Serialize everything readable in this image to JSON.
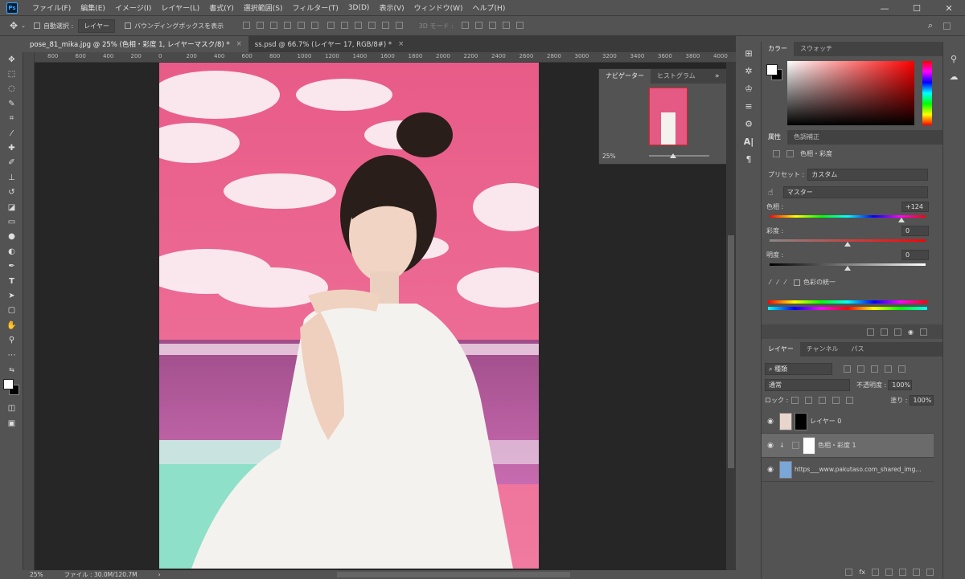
{
  "app": {
    "logo": "Ps"
  },
  "menu": [
    "ファイル(F)",
    "編集(E)",
    "イメージ(I)",
    "レイヤー(L)",
    "書式(Y)",
    "選択範囲(S)",
    "フィルター(T)",
    "3D(D)",
    "表示(V)",
    "ウィンドウ(W)",
    "ヘルプ(H)"
  ],
  "window_controls": {
    "minimize": "—",
    "maximize": "☐",
    "close": "✕"
  },
  "options": {
    "auto_select_label": "自動選択 :",
    "auto_select_value": "レイヤー",
    "bbox_label": "バウンディングボックスを表示",
    "mode3d": "3D モード :"
  },
  "doc_tabs": [
    {
      "label": "pose_81_mika.jpg @ 25% (色相・彩度 1, レイヤーマスク/8) *",
      "close": "×"
    },
    {
      "label": "ss.psd @ 66.7% (レイヤー 17, RGB/8#) *",
      "close": "×"
    }
  ],
  "ruler": [
    "800",
    "600",
    "400",
    "200",
    "0",
    "200",
    "400",
    "600",
    "800",
    "1000",
    "1200",
    "1400",
    "1600",
    "1800",
    "2000",
    "2200",
    "2400",
    "2600",
    "2800",
    "3000",
    "3200",
    "3400",
    "3600",
    "3800",
    "4000"
  ],
  "status": {
    "zoom": "25%",
    "file": "ファイル : 30.0M/120.7M",
    "arrow": "›"
  },
  "navigator": {
    "tabs": [
      "ナビゲーター",
      "ヒストグラム"
    ],
    "zoom": "25%",
    "more": "»",
    "menu": "≡"
  },
  "color_panel": {
    "tabs": [
      "カラー",
      "スウォッチ"
    ]
  },
  "properties": {
    "tabs": [
      "属性",
      "色調補正"
    ],
    "title": "色相・彩度",
    "preset_label": "プリセット :",
    "preset_value": "カスタム",
    "channel": "マスター",
    "hue_label": "色相 :",
    "hue_value": "+124",
    "hue": 124,
    "saturation_label": "彩度 :",
    "saturation_value": "0",
    "lightness_label": "明度 :",
    "lightness_value": "0",
    "colorize_label": "色彩の統一"
  },
  "layers": {
    "tabs": [
      "レイヤー",
      "チャンネル",
      "パス"
    ],
    "filter_label": "種類",
    "blend_mode": "通常",
    "opacity_label": "不透明度 :",
    "opacity_value": "100%",
    "lock_label": "ロック :",
    "fill_label": "塗り :",
    "fill_value": "100%",
    "items": [
      {
        "name": "レイヤー 0",
        "visible": true
      },
      {
        "name": "色相・彩度 1",
        "visible": true,
        "selected": true
      },
      {
        "name": "https___www.pakutaso.com_shared_img...",
        "visible": true
      }
    ]
  },
  "colors": {
    "accent": "#e45a84",
    "panel": "#535353",
    "dark": "#262626"
  }
}
